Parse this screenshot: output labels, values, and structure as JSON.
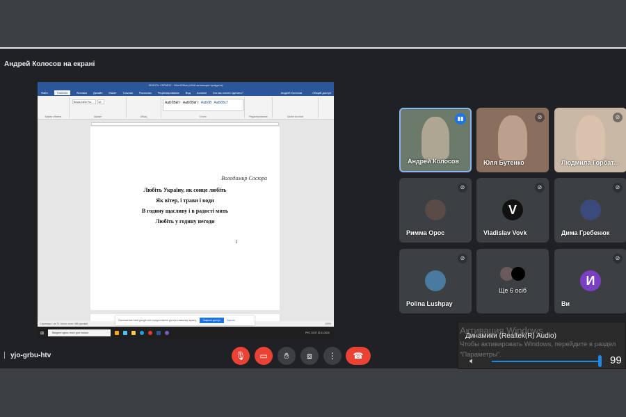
{
  "meeting": {
    "presenter_label": "Андрей Колосов на екрані",
    "code": "yjo-grbu-htv"
  },
  "word": {
    "title": "ЛЮБІТЬ УКРАЇНУ - WordOffice (сбой активации продукта)",
    "tabs": [
      "Файл",
      "Главная",
      "Вставка",
      "Дизайн",
      "Макет",
      "Ссылки",
      "Рассылки",
      "Рецензирование",
      "Вид",
      "Acrobat",
      "Что вы хотите сделать?"
    ],
    "user": "Андрей Колосов",
    "share": "Общий доступ",
    "groups": [
      "Буфер обмена",
      "Шрифт",
      "Абзац",
      "Стили",
      "Редактирование",
      "Adobe Acrobat"
    ],
    "font": "Times New Ro",
    "size": "12",
    "styles": [
      "АаБбВвГг",
      "АаБбВвГг",
      "АаБбВ",
      "АаБбВсГ"
    ],
    "document": {
      "author": "Володимир Сосюра",
      "lines": [
        "Любіть Україну, як сонце любіть",
        "Як вітер, і трави і води",
        "В годину щасливу і в радості мить",
        "Любіть у годину негоди"
      ],
      "page_number": "1"
    },
    "notice": {
      "text": "Приложение meet.google.com предоставлен доступ к вашему экрану.",
      "button": "Закрыть доступ",
      "link": "Скрыть"
    },
    "status": "Страница 1 из 74   Число слов: 466   русский",
    "zoom": "100%",
    "taskbar": {
      "search": "Введите здесь текст для поиска",
      "time": "13:07",
      "date": "22.11.2022",
      "lang": "РУС"
    }
  },
  "participants": [
    {
      "name": "Андрей Колосов",
      "speaking": true,
      "bg": "#6b7a6a"
    },
    {
      "name": "Юля Бутенко",
      "muted": true,
      "bg": "#8a6e5e"
    },
    {
      "name": "Людмила Горбат...",
      "muted": true,
      "bg": "#c9b8a5"
    },
    {
      "name": "Римма Орос",
      "muted": true,
      "avatar_color": "#5a4a48"
    },
    {
      "name": "Vladislav Vovk",
      "muted": true,
      "initial": "V",
      "avatar_color": "#111111"
    },
    {
      "name": "Дима Гребенюк",
      "muted": true,
      "avatar_color": "#3a4a7a"
    },
    {
      "name": "Polina Lushpay",
      "muted": true,
      "avatar_color": "#4a7aa0"
    },
    {
      "name": "Ще 6 осіб"
    },
    {
      "name": "Ви",
      "muted": true,
      "initial": "И",
      "avatar_color": "#7b3fc4"
    }
  ],
  "volume": {
    "watermark_title": "Активация Windows",
    "device": "Динамики (Realtek(R) Audio)",
    "watermark_text": "Чтобы активировать Windows, перейдите в раздел \"Параметры\".",
    "value": "99"
  }
}
